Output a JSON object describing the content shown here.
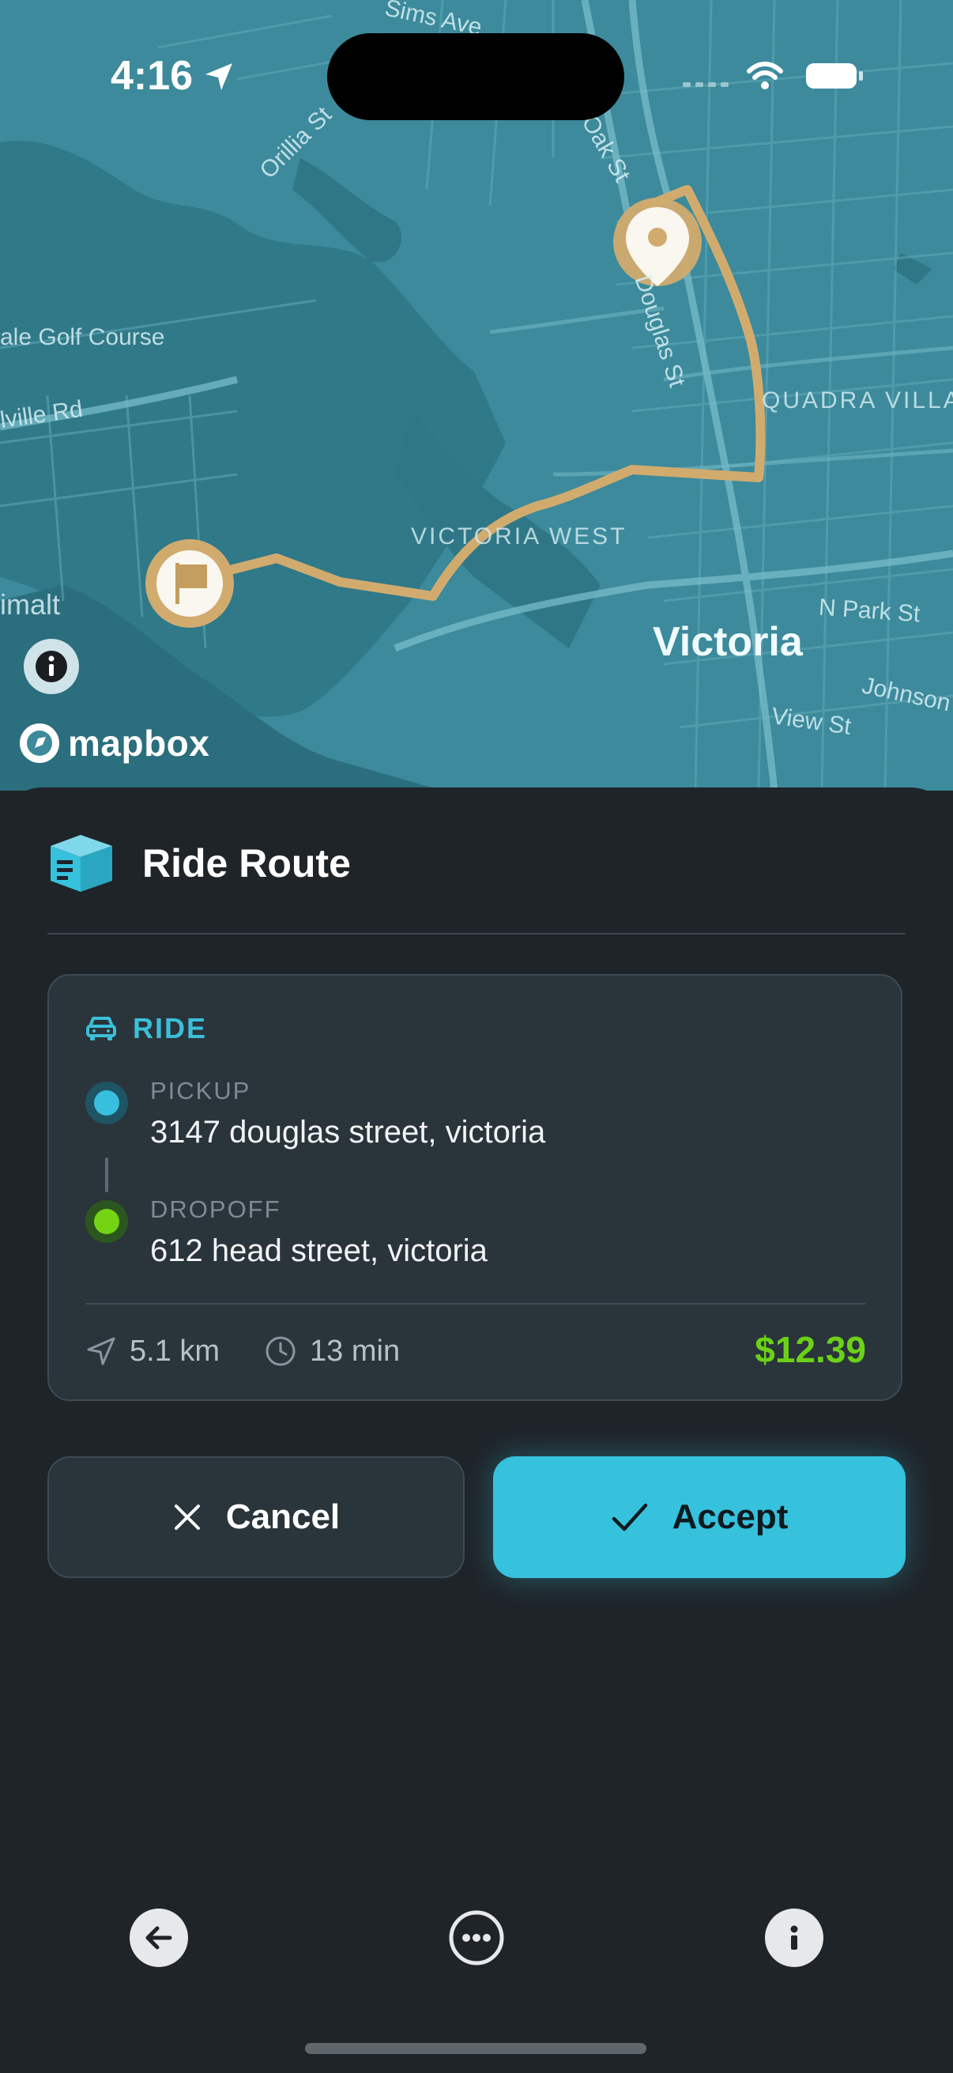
{
  "status_bar": {
    "time": "4:16"
  },
  "map": {
    "labels": {
      "sims_ave": "Sims Ave",
      "orillia_st": "Orillia St",
      "oak_st": "Oak St",
      "golf_course": "ale Golf Course",
      "melville_rd": "lville Rd",
      "douglas_st": "Douglas St",
      "quadra_village": "QUADRA VILLAGE",
      "victoria_west": "VICTORIA WEST",
      "victoria": "Victoria",
      "esquimalt": "imalt",
      "n_park_st": "N Park St",
      "johnson": "Johnson",
      "view_st": "View St"
    },
    "attribution": "mapbox",
    "route_color": "#d1ab6e"
  },
  "sheet": {
    "title": "Ride Route",
    "ride": {
      "tag": "RIDE",
      "pickup_label": "PICKUP",
      "pickup_address": "3147 douglas street, victoria",
      "dropoff_label": "DROPOFF",
      "dropoff_address": "612 head street, victoria",
      "distance": "5.1 km",
      "duration": "13 min",
      "price": "$12.39"
    },
    "buttons": {
      "cancel": "Cancel",
      "accept": "Accept"
    }
  },
  "colors": {
    "accent": "#36c1dd",
    "price": "#6bd117",
    "background": "#1f2429",
    "card": "#2a343b"
  }
}
